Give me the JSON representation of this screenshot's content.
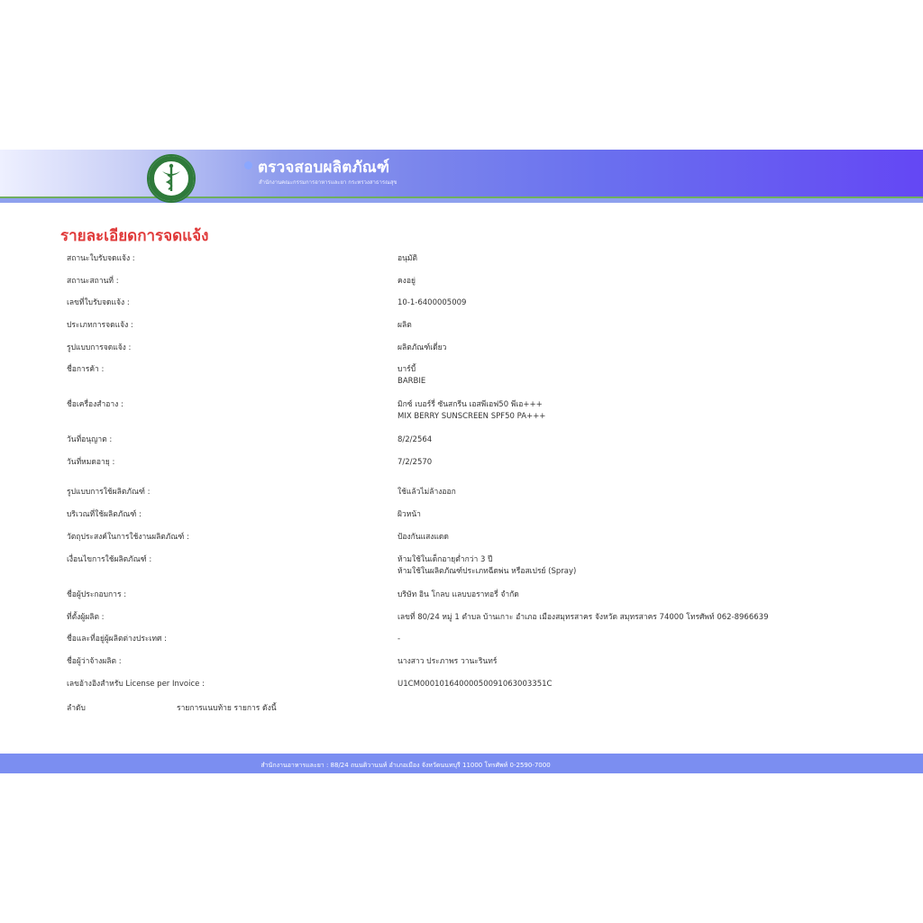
{
  "header": {
    "title": "ตรวจสอบผลิตภัณฑ์",
    "subtitle": "สำนักงานคณะกรรมการอาหารและยา กระทรวงสาธารณสุข",
    "logo_text": "MINISTRY OF PUBLIC HEALTH"
  },
  "page": {
    "heading": "รายละเอียดการจดแจ้ง"
  },
  "details": [
    {
      "label": "สถานะใบรับจดแจ้ง :",
      "value": [
        "อนุมัติ"
      ]
    },
    {
      "label": "สถานะสถานที่ :",
      "value": [
        "คงอยู่"
      ]
    },
    {
      "label": "เลขที่ใบรับจดแจ้ง :",
      "value": [
        "10-1-6400005009"
      ]
    },
    {
      "label": "ประเภทการจดแจ้ง :",
      "value": [
        "ผลิต"
      ]
    },
    {
      "label": "รูปแบบการจดแจ้ง :",
      "value": [
        "ผลิตภัณฑ์เดี่ยว"
      ]
    },
    {
      "label": "ชื่อการค้า :",
      "value": [
        "บาร์บี้",
        "BARBIE"
      ]
    },
    {
      "label": "ชื่อเครื่องสำอาง :",
      "value": [
        "มิกซ์ เบอร์รี่ ซันสกรีน เอสพีเอฟ50 พีเอ+++",
        "MIX BERRY SUNSCREEN SPF50 PA+++"
      ]
    },
    {
      "label": "วันที่อนุญาต :",
      "value": [
        "8/2/2564"
      ]
    },
    {
      "label": "วันที่หมดอายุ :",
      "value": [
        "7/2/2570"
      ]
    },
    {
      "label": "รูปแบบการใช้ผลิตภัณฑ์ :",
      "value": [
        "ใช้แล้วไม่ล้างออก"
      ]
    },
    {
      "label": "บริเวณที่ใช้ผลิตภัณฑ์ :",
      "value": [
        "ผิวหน้า"
      ]
    },
    {
      "label": "วัตถุประสงค์ในการใช้งานผลิตภัณฑ์ :",
      "value": [
        "ป้องกันแสงแดด"
      ]
    },
    {
      "label": "เงื่อนไขการใช้ผลิตภัณฑ์ :",
      "value": [
        "ห้ามใช้ในเด็กอายุต่ำกว่า 3 ปี",
        "ห้ามใช้ในผลิตภัณฑ์ประเภทฉีดพ่น หรือสเปรย์ (Spray)"
      ]
    },
    {
      "label": "ชื่อผู้ประกอบการ :",
      "value": [
        "บริษัท อิน โกลบ แลบบอราทอรี่ จำกัด"
      ]
    },
    {
      "label": "ที่ตั้งผู้ผลิต :",
      "value": [
        "เลขที่ 80/24 หมู่ 1 ตำบล บ้านเกาะ อำเภอ เมืองสมุทรสาคร จังหวัด สมุทรสาคร 74000 โทรศัพท์ 062-8966639"
      ]
    },
    {
      "label": "ชื่อและที่อยู่ผู้ผลิตต่างประเทศ :",
      "value": [
        "-"
      ]
    },
    {
      "label": "ชื่อผู้ว่าจ้างผลิต :",
      "value": [
        "นางสาว ประภาพร วานะรินทร์"
      ]
    },
    {
      "label": "เลขอ้างอิงสำหรับ License per Invoice :",
      "value": [
        "U1CM00010164000050091063003351C"
      ]
    }
  ],
  "order": {
    "label": "ลำดับ",
    "note": "รายการแนบท้าย รายการ ดังนี้"
  },
  "footer": {
    "text": "สำนักงานอาหารและยา : 88/24 ถนนติวานนท์ อำเภอเมือง จังหวัดนนทบุรี 11000 โทรศัพท์ 0-2590-7000"
  }
}
